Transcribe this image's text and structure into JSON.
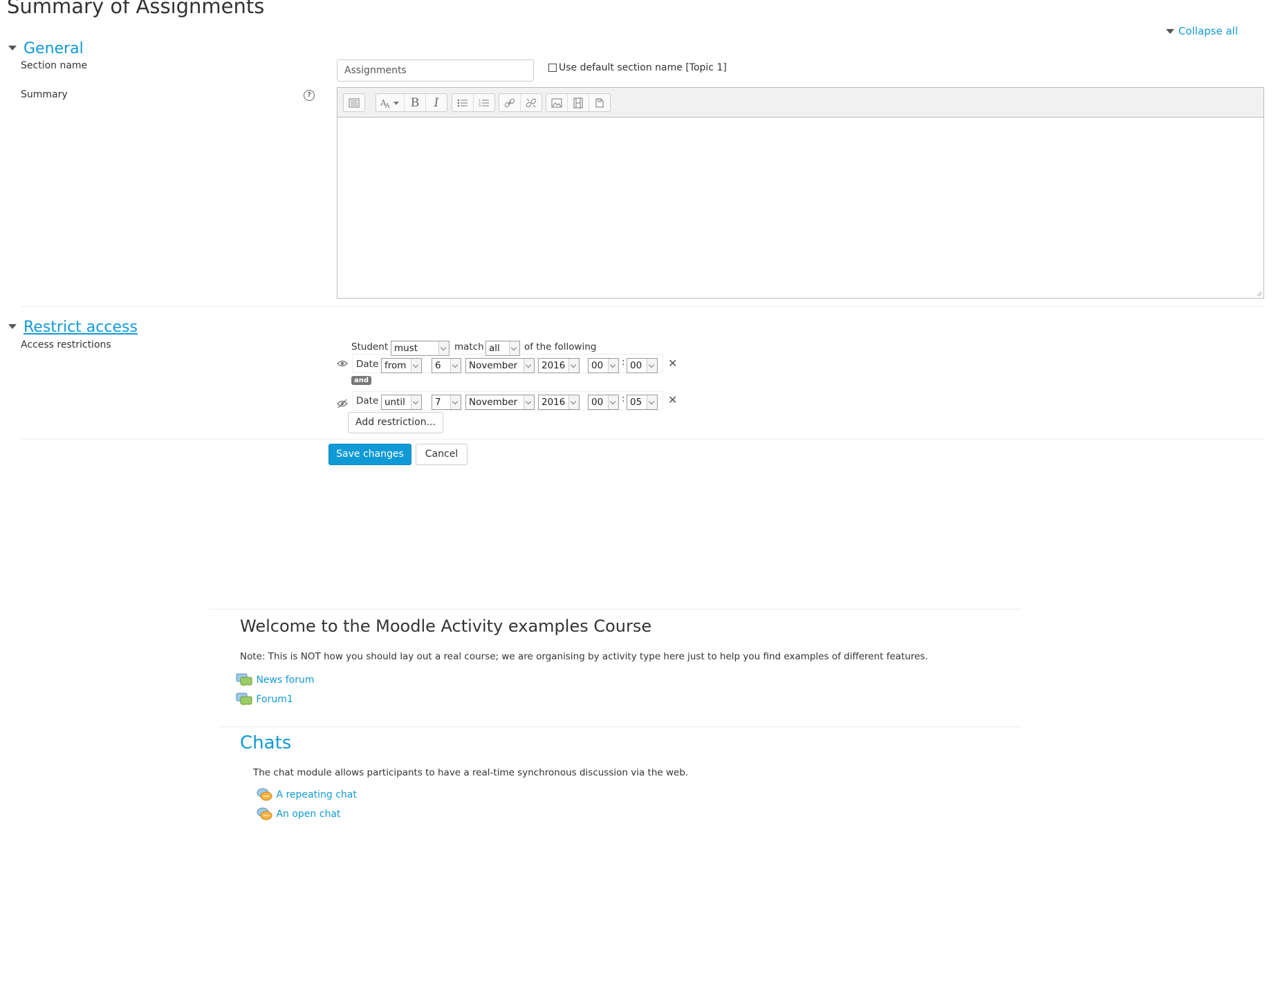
{
  "page": {
    "title": "Summary of Assignments",
    "collapse_all": "Collapse all"
  },
  "general": {
    "heading": "General",
    "section_name_label": "Section name",
    "section_name_value": "Assignments",
    "use_default_label": "Use default section name [Topic 1]",
    "summary_label": "Summary",
    "help_icon": "?"
  },
  "editor": {
    "toolbar_icons": [
      "collapse-icon",
      "font-style-icon",
      "bold-icon",
      "italic-icon",
      "unordered-list-icon",
      "ordered-list-icon",
      "link-icon",
      "unlink-icon",
      "image-icon",
      "media-icon",
      "file-icon"
    ],
    "bold": "B",
    "italic": "I"
  },
  "restrict": {
    "heading": "Restrict access",
    "access_label": "Access restrictions",
    "student_label": "Student",
    "must_value": "must",
    "match_label": "match",
    "all_value": "all",
    "following_label": "of the following",
    "and_label": "and",
    "conditions": [
      {
        "type": "Date",
        "direction": "from",
        "day": "6",
        "month": "November",
        "year": "2016",
        "hour": "00",
        "minute": "00"
      },
      {
        "type": "Date",
        "direction": "until",
        "day": "7",
        "month": "November",
        "year": "2016",
        "hour": "00",
        "minute": "05"
      }
    ],
    "time_sep": ":",
    "remove_symbol": "✕",
    "add_restriction": "Add restriction..."
  },
  "buttons": {
    "save": "Save changes",
    "cancel": "Cancel"
  },
  "course": {
    "title": "Welcome to the Moodle Activity examples Course",
    "note": "Note: This is NOT how you should lay out a real course; we are organising by activity type here just to help you find examples of different features.",
    "forums": [
      "News forum",
      "Forum1"
    ]
  },
  "chats": {
    "heading": "Chats",
    "description": "The chat module allows participants to have a real-time synchronous discussion via the web.",
    "items": [
      "A repeating chat",
      "An open chat"
    ]
  },
  "colors": {
    "accent": "#0f9ad6",
    "forum_icon": "#8bc34a",
    "chat_icon": "#f5a623"
  }
}
